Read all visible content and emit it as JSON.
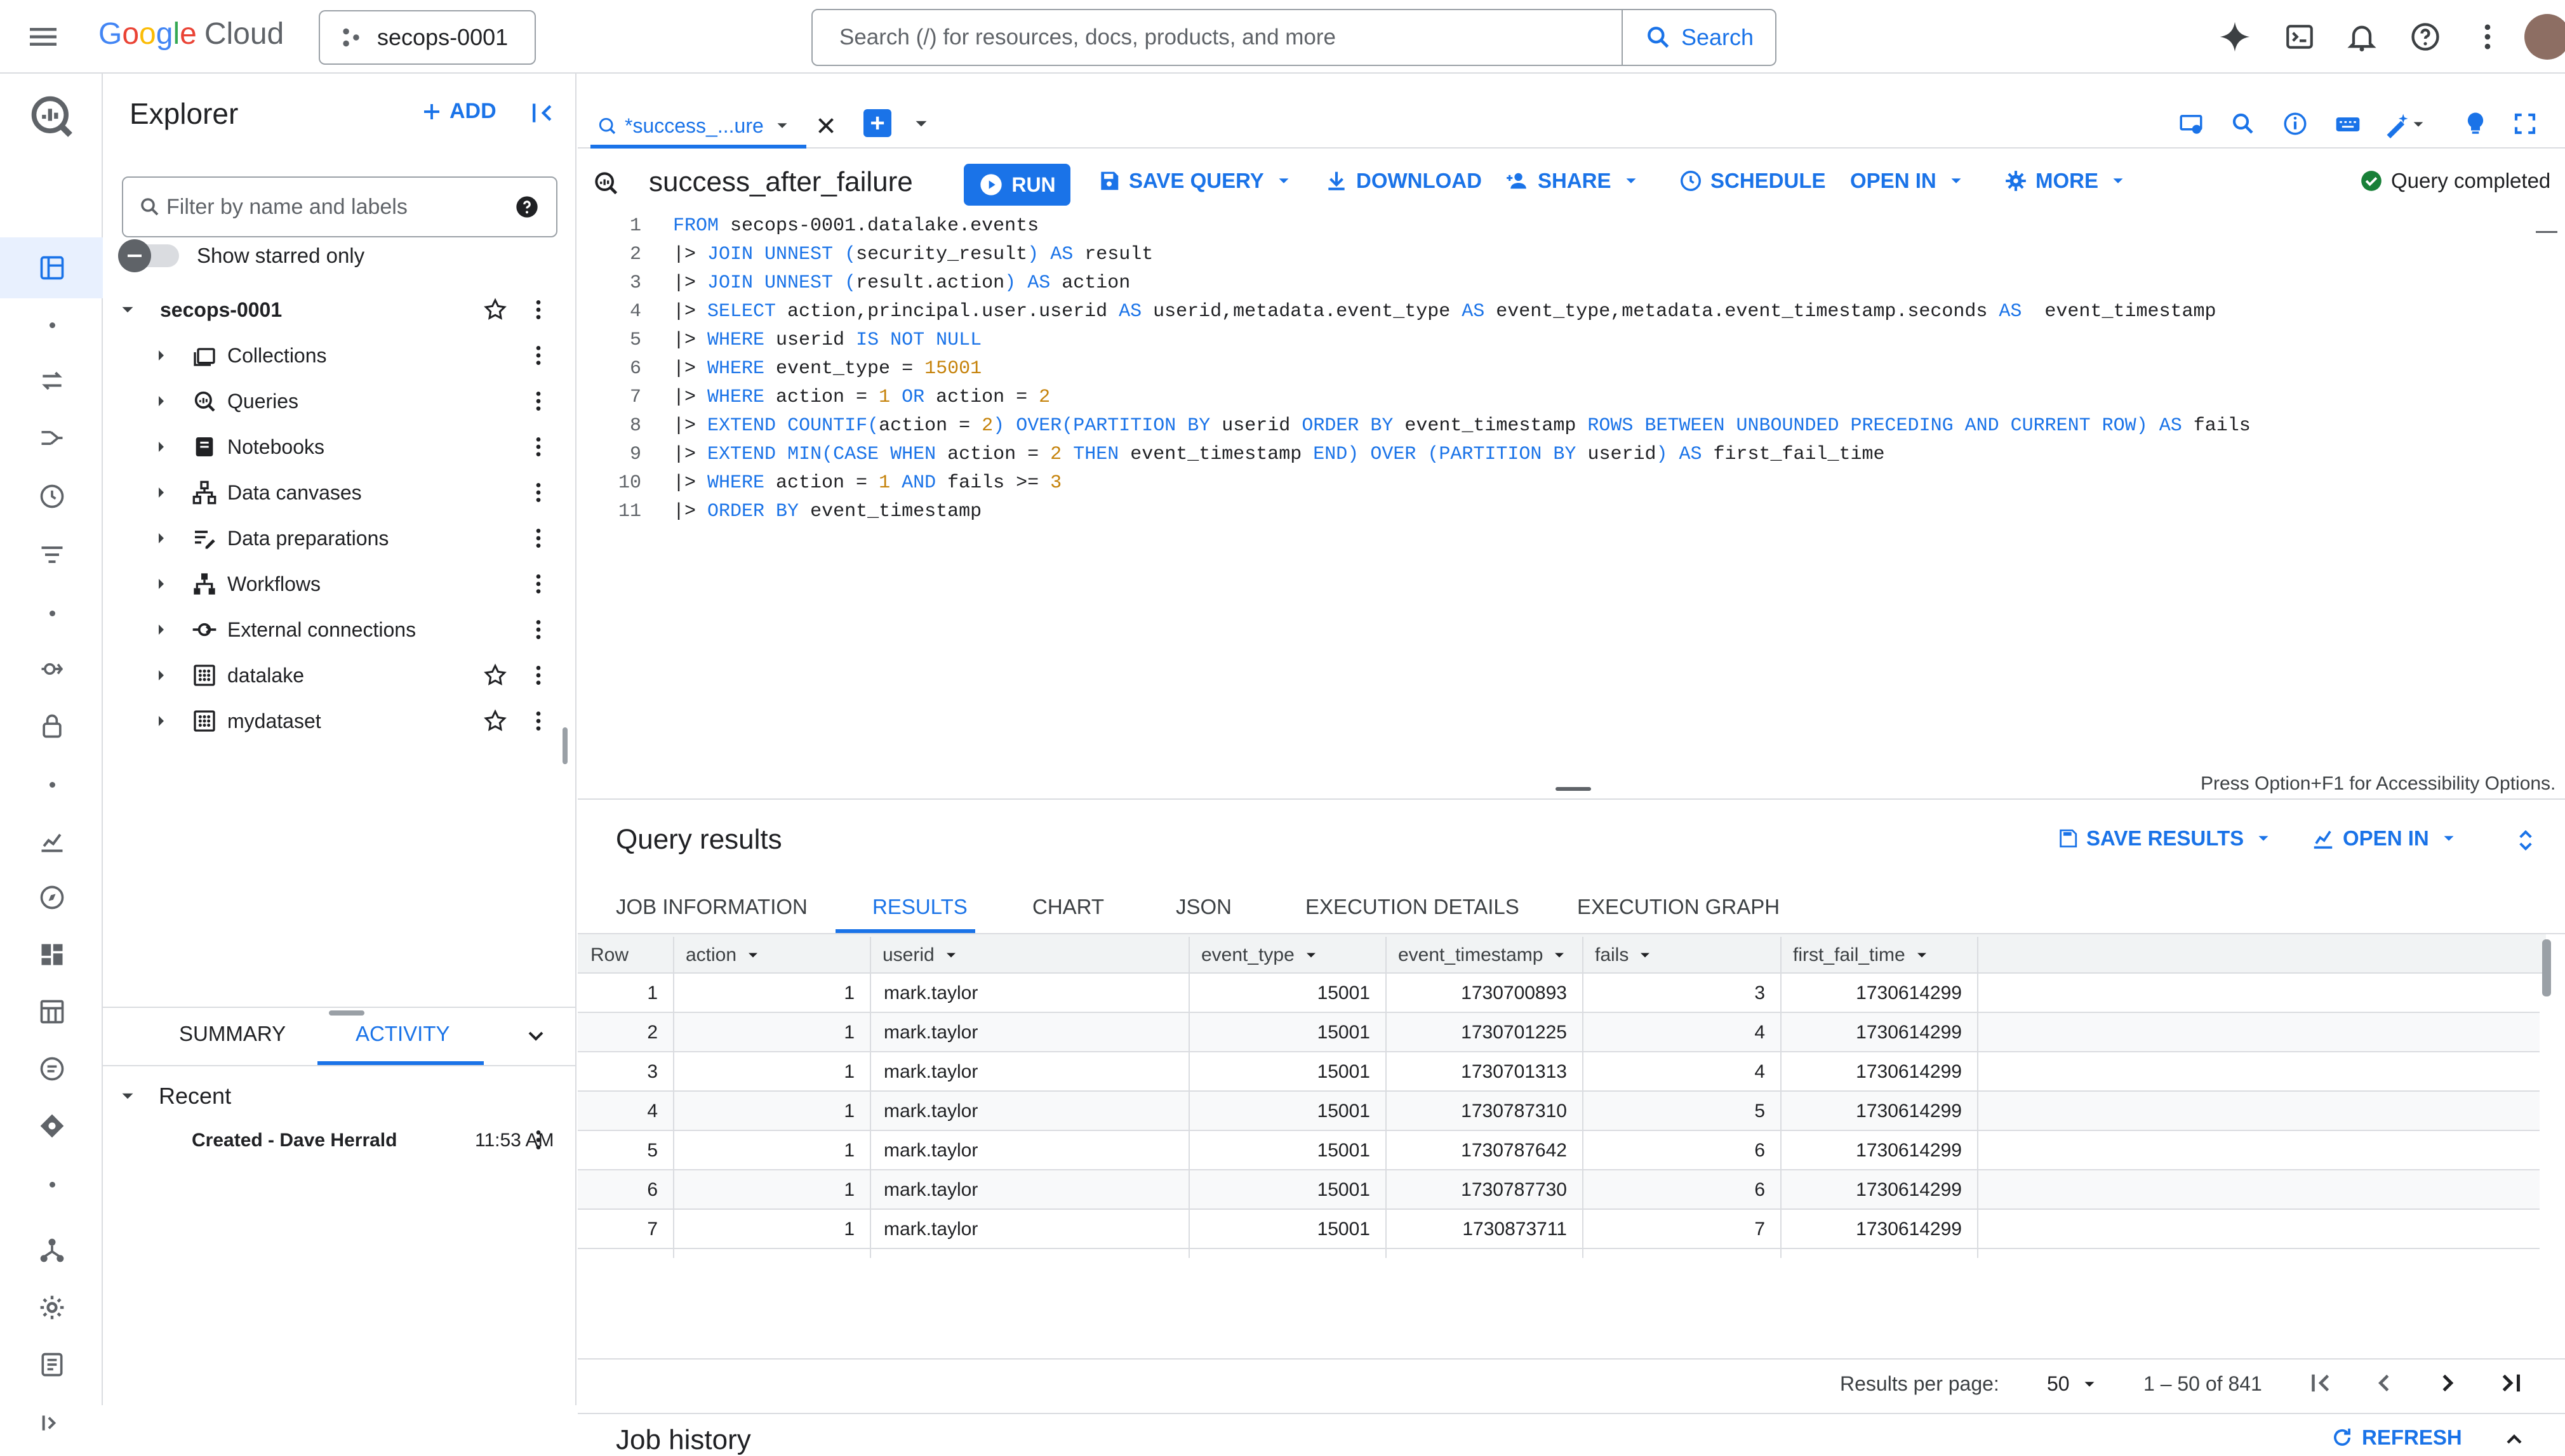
{
  "colors": {
    "accent": "#1a73e8",
    "success": "#188038",
    "text": "#202124",
    "muted": "#5f6368"
  },
  "topbar": {
    "logo_text": "Google",
    "logo_suffix": "Cloud",
    "project": "secops-0001",
    "search_placeholder": "Search (/) for resources, docs, products, and more",
    "search_button": "Search"
  },
  "explorer": {
    "title": "Explorer",
    "add_label": "ADD",
    "filter_placeholder": "Filter by name and labels",
    "starred_label": "Show starred only",
    "project_node": "secops-0001",
    "items": [
      {
        "label": "Collections",
        "icon": "collections-icon"
      },
      {
        "label": "Queries",
        "icon": "queries-icon"
      },
      {
        "label": "Notebooks",
        "icon": "notebook-icon"
      },
      {
        "label": "Data canvases",
        "icon": "data-canvas-icon"
      },
      {
        "label": "Data preparations",
        "icon": "data-preparation-icon"
      },
      {
        "label": "Workflows",
        "icon": "workflow-icon"
      },
      {
        "label": "External connections",
        "icon": "external-connection-icon"
      },
      {
        "label": "datalake",
        "icon": "dataset-icon"
      },
      {
        "label": "mydataset",
        "icon": "dataset-icon"
      }
    ],
    "bottom_tabs": {
      "summary": "SUMMARY",
      "activity": "ACTIVITY"
    },
    "recent_label": "Recent",
    "recent_item": "Created - Dave Herrald",
    "recent_time": "11:53 AM"
  },
  "editor": {
    "tab_label": "*success_...ure",
    "query_title": "success_after_failure",
    "toolbar": {
      "run": "RUN",
      "save_query": "SAVE QUERY",
      "download": "DOWNLOAD",
      "share": "SHARE",
      "schedule": "SCHEDULE",
      "open_in": "OPEN IN",
      "more": "MORE"
    },
    "status": "Query completed",
    "a11y_hint": "Press Option+F1 for Accessibility Options.",
    "code_lines": [
      "FROM secops-0001.datalake.events",
      "|> JOIN UNNEST (security_result) AS result",
      "|> JOIN UNNEST (result.action) AS action",
      "|> SELECT action,principal.user.userid AS userid,metadata.event_type AS event_type,metadata.event_timestamp.seconds AS  event_timestamp",
      "|> WHERE userid IS NOT NULL",
      "|> WHERE event_type = 15001",
      "|> WHERE action = 1 OR action = 2",
      "|> EXTEND COUNTIF(action = 2) OVER(PARTITION BY userid ORDER BY event_timestamp ROWS BETWEEN UNBOUNDED PRECEDING AND CURRENT ROW) AS fails",
      "|> EXTEND MIN(CASE WHEN action = 2 THEN event_timestamp END) OVER (PARTITION BY userid) AS first_fail_time",
      "|> WHERE action = 1 AND fails >= 3",
      "|> ORDER BY event_timestamp"
    ]
  },
  "results": {
    "title": "Query results",
    "save_results": "SAVE RESULTS",
    "open_in": "OPEN IN",
    "tabs": [
      "JOB INFORMATION",
      "RESULTS",
      "CHART",
      "JSON",
      "EXECUTION DETAILS",
      "EXECUTION GRAPH"
    ],
    "active_tab": "RESULTS",
    "columns": [
      "Row",
      "action",
      "userid",
      "event_type",
      "event_timestamp",
      "fails",
      "first_fail_time"
    ],
    "rows": [
      [
        "1",
        "1",
        "mark.taylor",
        "15001",
        "1730700893",
        "3",
        "1730614299"
      ],
      [
        "2",
        "1",
        "mark.taylor",
        "15001",
        "1730701225",
        "4",
        "1730614299"
      ],
      [
        "3",
        "1",
        "mark.taylor",
        "15001",
        "1730701313",
        "4",
        "1730614299"
      ],
      [
        "4",
        "1",
        "mark.taylor",
        "15001",
        "1730787310",
        "5",
        "1730614299"
      ],
      [
        "5",
        "1",
        "mark.taylor",
        "15001",
        "1730787642",
        "6",
        "1730614299"
      ],
      [
        "6",
        "1",
        "mark.taylor",
        "15001",
        "1730787730",
        "6",
        "1730614299"
      ],
      [
        "7",
        "1",
        "mark.taylor",
        "15001",
        "1730873711",
        "7",
        "1730614299"
      ]
    ],
    "pagination": {
      "label": "Results per page:",
      "per_page": "50",
      "range": "1 – 50 of 841"
    }
  },
  "job_history": {
    "title": "Job history",
    "refresh": "REFRESH"
  }
}
